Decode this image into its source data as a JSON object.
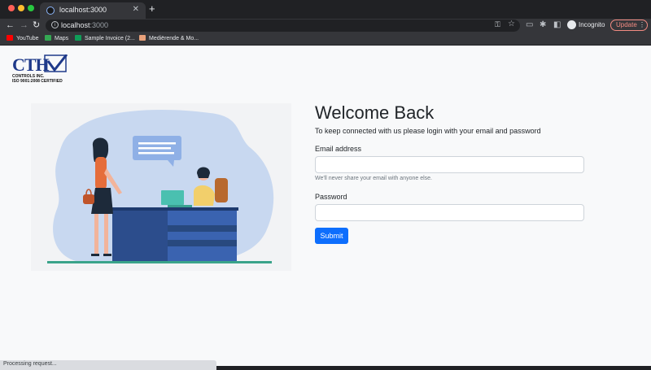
{
  "browser": {
    "tab_title": "localhost:3000",
    "url_host": "localhost",
    "url_port": ":3000",
    "incognito_label": "Incognito",
    "update_label": "Update",
    "bookmarks": [
      {
        "label": "YouTube"
      },
      {
        "label": "Maps"
      },
      {
        "label": "Sample Invoice (2..."
      },
      {
        "label": "Mediërende & Mo..."
      }
    ]
  },
  "logo": {
    "mark_text": "CTH",
    "line1": "CONTROLS INC.",
    "line2": "ISO 9001:2008 CERTIFIED"
  },
  "login": {
    "title": "Welcome Back",
    "subtitle": "To keep connected with us please login with your email and password",
    "email_label": "Email address",
    "email_value": "",
    "email_help": "We'll never share your email with anyone else.",
    "password_label": "Password",
    "password_value": "",
    "submit_label": "Submit"
  },
  "status_bar": {
    "text": "Processing request..."
  }
}
